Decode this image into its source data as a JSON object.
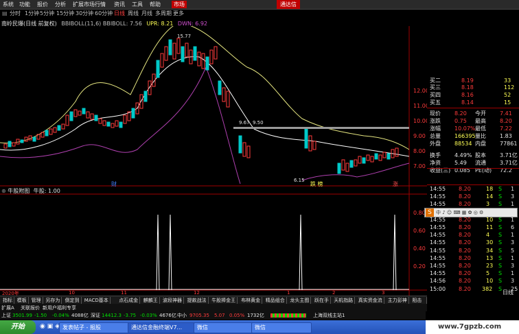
{
  "menubar": {
    "items": [
      "系统",
      "功能",
      "报价",
      "分析",
      "扩展市场行情",
      "资讯",
      "工具",
      "帮助"
    ],
    "market_label": "市场",
    "brand_label": "通达信"
  },
  "periods": {
    "items": [
      "分时",
      "1分钟",
      "5分钟",
      "15分钟",
      "30分钟",
      "60分钟",
      "日线",
      "周线",
      "月线",
      "多周期",
      "更多"
    ],
    "active_index": 6
  },
  "chart_header": {
    "stock": "南岭民爆(日线 前复权)",
    "indicator": "BBIBOLL(11,6) BBIBOLL: 7.56",
    "upr": "UPR: 8.21",
    "dwn": "DWN: 6.92"
  },
  "price_axis": {
    "ticks": [
      "12.00",
      "11.00",
      "10.00",
      "9.00",
      "8.00",
      "7.00"
    ],
    "top_annot": "15.77",
    "line_annot_left": "9.67",
    "line_annot_right": "9.50",
    "low_annot": "6.15"
  },
  "event_markers": {
    "left": "财",
    "mid": "跌 榜",
    "right": "涨"
  },
  "sub_header": {
    "title": "牛股附图",
    "value": "牛股: 1.00"
  },
  "sub_axis": {
    "ticks": [
      "0.80",
      "0.60",
      "0.40",
      "0.20"
    ]
  },
  "date_axis": {
    "labels": [
      "2020年",
      "10",
      "11",
      "12",
      "1",
      "2",
      "3"
    ]
  },
  "quote_panel": {
    "rows": [
      {
        "label": "买二",
        "value": "8.19",
        "vol": "33"
      },
      {
        "label": "买三",
        "value": "8.18",
        "vol": "112"
      },
      {
        "label": "买四",
        "value": "8.16",
        "vol": "52"
      },
      {
        "label": "买五",
        "value": "8.14",
        "vol": "15"
      }
    ],
    "stats": [
      {
        "l1": "现价",
        "v1": "8.20",
        "l2": "今开",
        "v2": "7.41"
      },
      {
        "l1": "涨跌",
        "v1": "0.75",
        "l2": "最高",
        "v2": "8.20"
      },
      {
        "l1": "涨幅",
        "v1": "10.07%",
        "l2": "最低",
        "v2": "7.22"
      },
      {
        "l1": "总量",
        "v1": "166395",
        "l2": "量比",
        "v2": "1.83"
      },
      {
        "l1": "外盘",
        "v1": "88534",
        "l2": "内盘",
        "v2": "77861"
      },
      {
        "l1": "换手",
        "v1": "4.49%",
        "l2": "股本",
        "v2": "3.71亿"
      },
      {
        "l1": "净资",
        "v1": "5.49",
        "l2": "流通",
        "v2": "3.71亿"
      },
      {
        "l1": "收益(三)",
        "v1": "0.085",
        "l2": "PE(动)",
        "v2": "72.2"
      }
    ],
    "ticks": [
      {
        "t": "14:55",
        "p": "8.20",
        "v": "18",
        "d": "S",
        "n": "1"
      },
      {
        "t": "14:55",
        "p": "8.20",
        "v": "14",
        "d": "S",
        "n": "3"
      },
      {
        "t": "14:55",
        "p": "8.20",
        "v": "3",
        "d": "S",
        "n": "1"
      },
      {
        "t": "14:55",
        "p": "8.20",
        "v": "10",
        "d": "S",
        "n": "1"
      },
      {
        "t": "14:55",
        "p": "8.20",
        "v": "10",
        "d": "S",
        "n": "1"
      },
      {
        "t": "14:55",
        "p": "8.20",
        "v": "11",
        "d": "S",
        "n": "6"
      },
      {
        "t": "14:55",
        "p": "8.20",
        "v": "4",
        "d": "S",
        "n": "1"
      },
      {
        "t": "14:55",
        "p": "8.20",
        "v": "30",
        "d": "S",
        "n": "3"
      },
      {
        "t": "14:55",
        "p": "8.20",
        "v": "34",
        "d": "S",
        "n": "5"
      },
      {
        "t": "14:55",
        "p": "8.20",
        "v": "13",
        "d": "S",
        "n": "1"
      },
      {
        "t": "14:55",
        "p": "8.20",
        "v": "23",
        "d": "S",
        "n": "3"
      },
      {
        "t": "14:55",
        "p": "8.20",
        "v": "5",
        "d": "S",
        "n": "1"
      },
      {
        "t": "14:56",
        "p": "8.20",
        "v": "10",
        "d": "S",
        "n": "3"
      },
      {
        "t": "15:00",
        "p": "8.20",
        "v": "382",
        "d": "S",
        "n": "25"
      }
    ],
    "day_label": "日线"
  },
  "tabs": [
    "指标",
    "模板",
    "管理",
    "另存为",
    "倒定到",
    "MACD基本",
    "点石成金",
    "麒麟王",
    "波段神器",
    "提款战法",
    "牛股捧金王",
    "布林黄金",
    "精品组合",
    "龙头主图",
    "跃在手",
    "天机指路",
    "真实资金流",
    "主力彭神",
    "阻击主力"
  ],
  "status": {
    "left": "扩展A",
    "mid": "关联报价",
    "right": "新用户福利专享"
  },
  "indexbar": {
    "sh_label": "上证",
    "sh_value": "3501.99",
    "sh_change": "-1.50",
    "sh_pct": "-0.04%",
    "sh_amount": "4088亿",
    "sz_label": "深证",
    "sz_value": "14412.3",
    "sz_change": "-3.75",
    "sz_pct": "-0.03%",
    "sz_amount": "4676亿",
    "zx_label": "中小",
    "zx_value": "9705.35",
    "zx_change": "5.07",
    "zx_pct": "0.05%",
    "zx_amount": "1732亿",
    "server": "上海双线主站1"
  },
  "taskbar": {
    "start": "开始",
    "tasks": [
      "发表帖子 - 报股",
      "通达信金融终端V7...",
      "微信",
      "微信"
    ]
  },
  "watermark": "www.7gpzb.com",
  "colors": {
    "up": "#ff3b3b",
    "down": "#00e000",
    "bollmid": "#ffffff",
    "bollupper": "#e6e680",
    "bolllower": "#b040b0"
  }
}
